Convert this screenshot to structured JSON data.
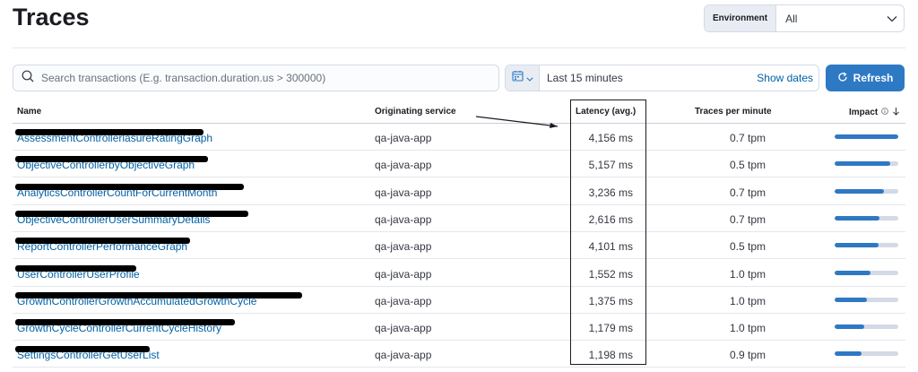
{
  "page": {
    "title": "Traces"
  },
  "environment": {
    "label": "Environment",
    "value": "All"
  },
  "search": {
    "placeholder": "Search transactions (E.g. transaction.duration.us > 300000)"
  },
  "datepicker": {
    "range": "Last 15 minutes",
    "show_dates": "Show dates"
  },
  "refresh": {
    "label": "Refresh"
  },
  "table": {
    "columns": {
      "name": "Name",
      "service": "Originating service",
      "latency": "Latency (avg.)",
      "tpm": "Traces per minute",
      "impact": "Impact"
    },
    "rows": [
      {
        "name": "AssessmentControllerlasureRatingGraph",
        "service": "qa-java-app",
        "latency": "4,156 ms",
        "tpm": "0.7 tpm",
        "impact": 1.0
      },
      {
        "name": "ObjectiveControllerbyObjectiveGraph",
        "service": "qa-java-app",
        "latency": "5,157 ms",
        "tpm": "0.5 tpm",
        "impact": 0.87
      },
      {
        "name": "AnalyticsControllerCountForCurrentMonth",
        "service": "qa-java-app",
        "latency": "3,236 ms",
        "tpm": "0.7 tpm",
        "impact": 0.78
      },
      {
        "name": "ObjectiveControllerUserSummaryDetails",
        "service": "qa-java-app",
        "latency": "2,616 ms",
        "tpm": "0.7 tpm",
        "impact": 0.7
      },
      {
        "name": "ReportControllerPerformanceGraph",
        "service": "qa-java-app",
        "latency": "4,101 ms",
        "tpm": "0.5 tpm",
        "impact": 0.69
      },
      {
        "name": "UserControllerUserProfile",
        "service": "qa-java-app",
        "latency": "1,552 ms",
        "tpm": "1.0 tpm",
        "impact": 0.57
      },
      {
        "name": "GrowthControllerGrowthAccumulatedGrowthCycle",
        "service": "qa-java-app",
        "latency": "1,375 ms",
        "tpm": "1.0 tpm",
        "impact": 0.51
      },
      {
        "name": "GrowthCycleControllerCurrentCycleHistory",
        "service": "qa-java-app",
        "latency": "1,179 ms",
        "tpm": "1.0 tpm",
        "impact": 0.47
      },
      {
        "name": "SettingsControllerGetUserList",
        "service": "qa-java-app",
        "latency": "1,198 ms",
        "tpm": "0.9 tpm",
        "impact": 0.42
      }
    ]
  },
  "icons": {
    "search": "search-icon",
    "calendar": "calendar-icon",
    "refresh": "refresh-icon",
    "info": "info-icon",
    "sort": "arrow-down-icon"
  },
  "colors": {
    "link": "#0061a6",
    "accent": "#2e79c4",
    "track": "#d3dae6"
  }
}
